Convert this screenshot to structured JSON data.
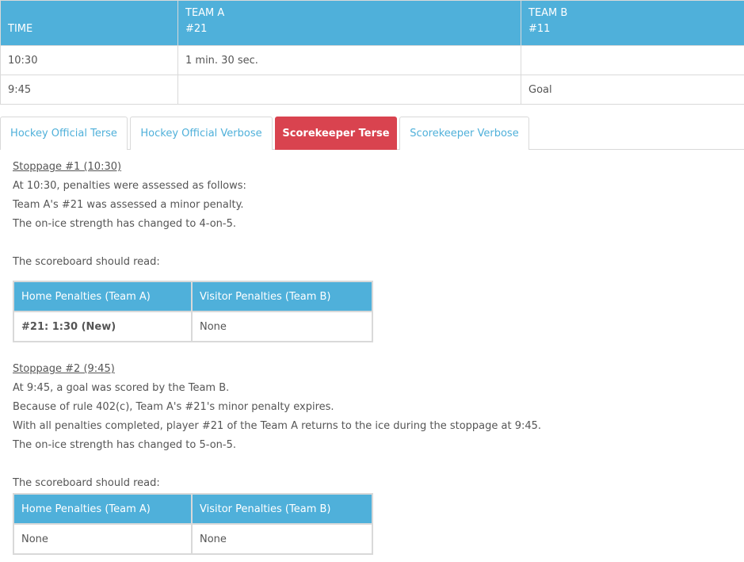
{
  "events_table": {
    "headers": {
      "time": "TIME",
      "team_a_name": "TEAM A",
      "team_a_player": "#21",
      "team_b_name": "TEAM B",
      "team_b_player": "#11"
    },
    "rows": [
      {
        "time": "10:30",
        "team_a": "1 min. 30 sec.",
        "team_b": ""
      },
      {
        "time": "9:45",
        "team_a": "",
        "team_b": "Goal"
      }
    ]
  },
  "tabs": [
    {
      "label": "Hockey Official Terse",
      "active": false
    },
    {
      "label": "Hockey Official Verbose",
      "active": false
    },
    {
      "label": "Scorekeeper Terse",
      "active": true
    },
    {
      "label": "Scorekeeper Verbose",
      "active": false
    }
  ],
  "stoppages": [
    {
      "title": "Stoppage #1 (10:30)",
      "lines": [
        "At 10:30, penalties were assessed as follows:",
        "Team A's #21 was assessed a minor penalty.",
        "The on-ice strength has changed to 4-on-5."
      ],
      "scoreboard_intro": "The scoreboard should read:",
      "scoreboard": {
        "home_header": "Home Penalties (Team A)",
        "visitor_header": "Visitor Penalties (Team B)",
        "home_value": "#21: 1:30 (New)",
        "visitor_value": "None"
      }
    },
    {
      "title": "Stoppage #2 (9:45)",
      "lines": [
        "At 9:45, a goal was scored by the Team B.",
        "Because of rule 402(c), Team A's #21's minor penalty expires.",
        "With all penalties completed, player #21 of the Team A returns to the ice during the stoppage at 9:45.",
        "The on-ice strength has changed to 5-on-5."
      ],
      "scoreboard_intro": "The scoreboard should read:",
      "scoreboard": {
        "home_header": "Home Penalties (Team A)",
        "visitor_header": "Visitor Penalties (Team B)",
        "home_value": "None",
        "visitor_value": "None"
      }
    }
  ],
  "colors": {
    "header_blue": "#4fb0da",
    "active_tab_red": "#d9434f",
    "text_gray": "#555555",
    "border_gray": "#d9d9d9"
  }
}
